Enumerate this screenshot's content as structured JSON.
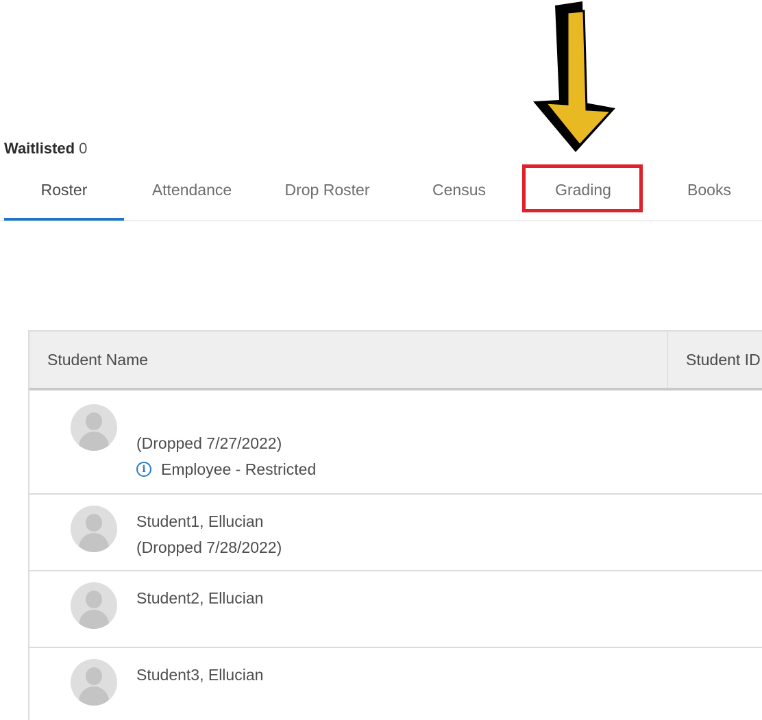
{
  "waitlisted": {
    "label": "Waitlisted",
    "count": "0"
  },
  "tabs": [
    {
      "label": "Roster",
      "active": true
    },
    {
      "label": "Attendance",
      "active": false
    },
    {
      "label": "Drop Roster",
      "active": false
    },
    {
      "label": "Census",
      "active": false
    },
    {
      "label": "Grading",
      "active": false,
      "highlighted": true
    },
    {
      "label": "Books",
      "active": false
    }
  ],
  "table": {
    "columns": [
      "Student Name",
      "Student ID"
    ],
    "rows": [
      {
        "name": "",
        "status": "(Dropped 7/27/2022)",
        "flag": "Employee - Restricted"
      },
      {
        "name": "Student1, Ellucian",
        "status": "(Dropped 7/28/2022)"
      },
      {
        "name": "Student2, Ellucian"
      },
      {
        "name": "Student3, Ellucian"
      }
    ]
  },
  "colors": {
    "active_tab_underline": "#1f76c6",
    "highlight_box": "#e0202a",
    "arrow_fill": "#e8b923",
    "arrow_outline": "#000000",
    "info_icon": "#2b7bc6"
  },
  "icons": {
    "arrow": "down-arrow-icon",
    "info": "info-icon",
    "avatar": "user-avatar-icon"
  }
}
